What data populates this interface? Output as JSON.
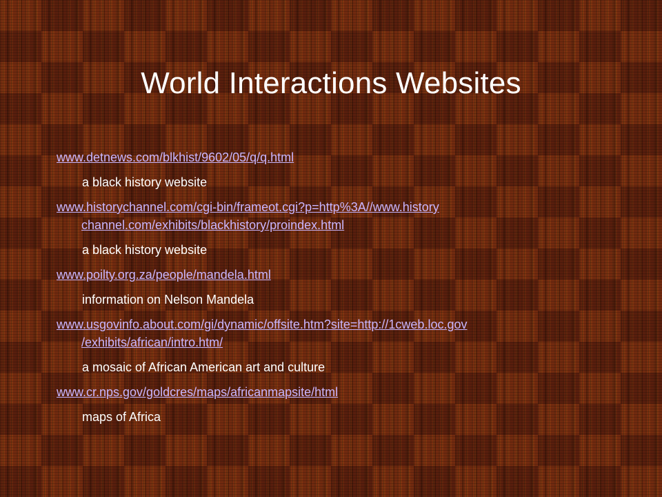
{
  "slide": {
    "title": "World Interactions Websites",
    "items": [
      {
        "link": "www.detnews.com/blkhist/9602/05/q/q.html",
        "description": "a black history website"
      },
      {
        "link": "www.historychannel.com/cgi-bin/frameot.cgi?p=http%3A//www.history channel.com/exhibits/blackhistory/proindex.html",
        "description": "a black history website"
      },
      {
        "link": "www.poilty.org.za/people/mandela.html",
        "description": "information on Nelson Mandela"
      },
      {
        "link": "www.usgovinfo.about.com/gi/dynamic/offsite.htm?site=http://1cweb.loc.gov /exhibits/african/intro.htm/",
        "description": "a mosaic of African American art and culture"
      },
      {
        "link": "www.cr.nps.gov/goldcres/maps/africanmapsite/html",
        "description": "maps of Africa"
      }
    ]
  },
  "colors": {
    "title_text": "#ffffff",
    "link_text": "#c9b6ff",
    "description_text": "#ffffff",
    "background_brown": "#6b2a12"
  }
}
